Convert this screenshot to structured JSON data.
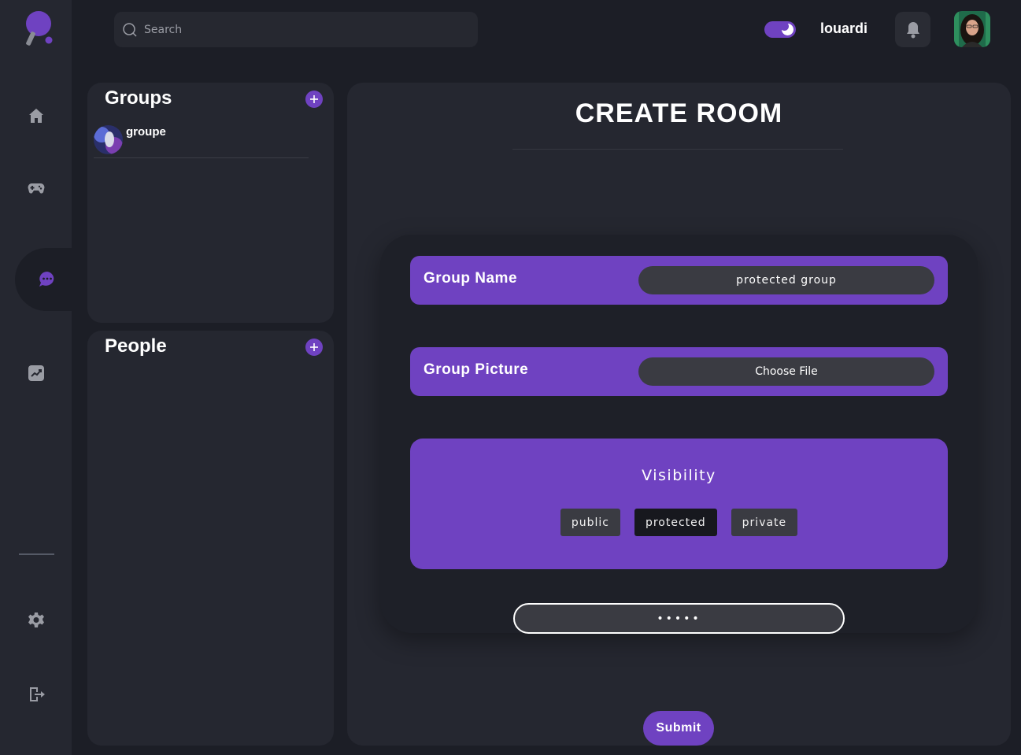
{
  "header": {
    "search_placeholder": "Search",
    "username": "louardi",
    "theme_toggle_on": true
  },
  "sidebar": {
    "items": [
      {
        "name": "home",
        "icon": "home-icon"
      },
      {
        "name": "game",
        "icon": "gamepad-icon"
      },
      {
        "name": "chat",
        "icon": "chat-icon",
        "active": true
      },
      {
        "name": "stats",
        "icon": "chart-icon"
      },
      {
        "name": "settings",
        "icon": "gear-icon"
      },
      {
        "name": "logout",
        "icon": "logout-icon"
      }
    ]
  },
  "groups_panel": {
    "title": "Groups",
    "items": [
      {
        "name": "groupe"
      }
    ]
  },
  "people_panel": {
    "title": "People",
    "items": []
  },
  "create_room": {
    "title": "CREATE ROOM",
    "group_name_label": "Group Name",
    "group_name_value": "protected group",
    "group_picture_label": "Group Picture",
    "choose_file_label": "Choose File",
    "visibility_label": "Visibility",
    "visibility_options": [
      "public",
      "protected",
      "private"
    ],
    "visibility_selected": "protected",
    "password_value": "•••••",
    "submit_label": "Submit"
  },
  "colors": {
    "accent": "#6f42c1",
    "background": "#1c1e26",
    "panel": "#252730"
  }
}
